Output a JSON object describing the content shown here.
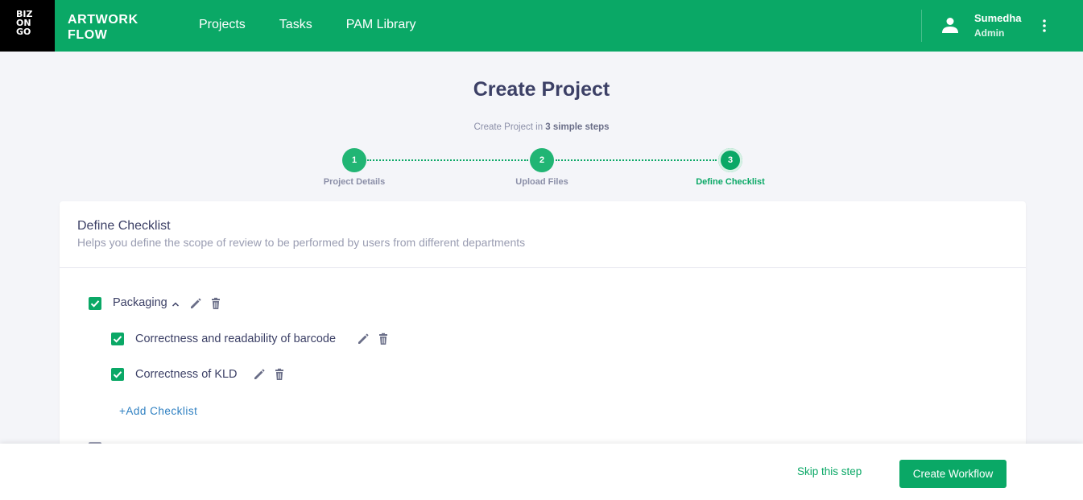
{
  "logo": {
    "lines": [
      "BIZ",
      "ON",
      "GO"
    ]
  },
  "app": {
    "title_line1": "ARTWORK",
    "title_line2": "FLOW"
  },
  "nav": {
    "items": [
      "Projects",
      "Tasks",
      "PAM Library"
    ]
  },
  "user": {
    "name": "Sumedha",
    "role": "Admin"
  },
  "page": {
    "title": "Create Project",
    "subtitle_prefix": "Create Project in ",
    "subtitle_bold": "3 simple steps"
  },
  "stepper": {
    "steps": [
      {
        "number": "1",
        "label": "Project Details"
      },
      {
        "number": "2",
        "label": "Upload Files"
      },
      {
        "number": "3",
        "label": "Define Checklist"
      }
    ],
    "active_step": 3
  },
  "checklist": {
    "title": "Define Checklist",
    "description": "Helps you define the scope of review to be performed by users from different departments",
    "groups": [
      {
        "name": "Packaging",
        "checked": true,
        "expanded": true,
        "items": [
          {
            "label": "Correctness and readability of barcode",
            "checked": true
          },
          {
            "label": "Correctness of KLD",
            "checked": true
          }
        ],
        "add_label": "+Add Checklist"
      }
    ]
  },
  "footer": {
    "skip_label": "Skip this step",
    "create_label": "Create Workflow"
  },
  "colors": {
    "brand": "#0aa866",
    "logo_bg": "#000000",
    "link": "#2d7fc1",
    "text": "#3c4066"
  }
}
